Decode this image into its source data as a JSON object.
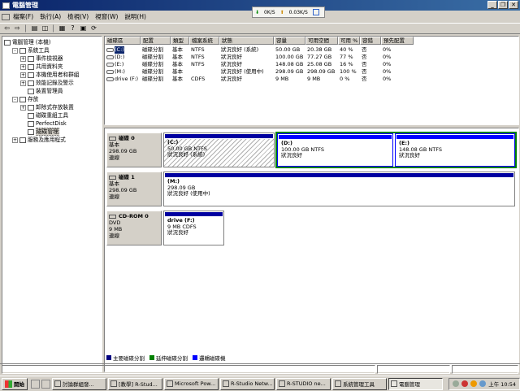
{
  "window": {
    "title": "電腦管理"
  },
  "netmeter": {
    "down": "0K/S",
    "up": "0.03K/S"
  },
  "menu": [
    "檔案(F)",
    "執行(A)",
    "檢視(V)",
    "視窗(W)",
    "說明(H)"
  ],
  "tree": [
    {
      "label": "電腦管理 (本機)",
      "level": 0,
      "expander": ""
    },
    {
      "label": "系統工具",
      "level": 1,
      "expander": "-"
    },
    {
      "label": "事件檢視器",
      "level": 2,
      "expander": "+"
    },
    {
      "label": "共用資料夾",
      "level": 2,
      "expander": "+"
    },
    {
      "label": "本機使用者和群組",
      "level": 2,
      "expander": "+"
    },
    {
      "label": "效能記錄及警示",
      "level": 2,
      "expander": "+"
    },
    {
      "label": "裝置管理員",
      "level": 2,
      "expander": ""
    },
    {
      "label": "存放",
      "level": 1,
      "expander": "-"
    },
    {
      "label": "卸除式存放裝置",
      "level": 2,
      "expander": "+"
    },
    {
      "label": "磁碟重組工具",
      "level": 2,
      "expander": ""
    },
    {
      "label": "PerfectDisk",
      "level": 2,
      "expander": ""
    },
    {
      "label": "磁碟管理",
      "level": 2,
      "expander": "",
      "selected": true
    },
    {
      "label": "服務及應用程式",
      "level": 1,
      "expander": "+"
    }
  ],
  "volume_table": {
    "columns": [
      "磁碟區",
      "配置",
      "類型",
      "檔案系統",
      "狀態",
      "容量",
      "可用空間",
      "可用 %",
      "容錯",
      "預先配置"
    ],
    "rows": [
      [
        "(C:)",
        "磁碟分割",
        "基本",
        "NTFS",
        "狀況良好 (系統)",
        "50.00 GB",
        "20.38 GB",
        "40 %",
        "否",
        "0%"
      ],
      [
        "(D:)",
        "磁碟分割",
        "基本",
        "NTFS",
        "狀況良好",
        "100.00 GB",
        "77.27 GB",
        "77 %",
        "否",
        "0%"
      ],
      [
        "(E:)",
        "磁碟分割",
        "基本",
        "NTFS",
        "狀況良好",
        "148.08 GB",
        "25.08 GB",
        "16 %",
        "否",
        "0%"
      ],
      [
        "(M:)",
        "磁碟分割",
        "基本",
        "",
        "狀況良好 (使用中)",
        "298.09 GB",
        "298.09 GB",
        "100 %",
        "否",
        "0%"
      ],
      [
        "drive (F:)",
        "磁碟分割",
        "基本",
        "CDFS",
        "狀況良好",
        "9 MB",
        "9 MB",
        "0 %",
        "否",
        "0%"
      ]
    ]
  },
  "disks": [
    {
      "name": "磁碟 0",
      "type": "基本",
      "size": "298.09 GB",
      "status": "連線",
      "partitions": [
        {
          "title": "(C:)",
          "detail": "50.00 GB NTFS",
          "status": "狀況良好 (系統)"
        },
        {
          "title": "(D:)",
          "detail": "100.00 GB NTFS",
          "status": "狀況良好"
        },
        {
          "title": "(E:)",
          "detail": "148.08 GB NTFS",
          "status": "狀況良好"
        }
      ]
    },
    {
      "name": "磁碟 1",
      "type": "基本",
      "size": "298.09 GB",
      "status": "連線",
      "partitions": [
        {
          "title": "(M:)",
          "detail": "298.09 GB",
          "status": "狀況良好 (使用中)"
        }
      ]
    },
    {
      "name": "CD-ROM 0",
      "type": "DVD",
      "size": "9 MB",
      "status": "連線",
      "partitions": [
        {
          "title": "drive  (F:)",
          "detail": "9 MB CDFS",
          "status": "狀況良好"
        }
      ]
    }
  ],
  "legend": [
    {
      "label": "主要磁碟分割",
      "color": "#000080"
    },
    {
      "label": "延伸磁碟分割",
      "color": "#008000"
    },
    {
      "label": "邏輯磁碟機",
      "color": "#0000ff"
    }
  ],
  "taskbar": {
    "start": "開始",
    "tasks": [
      "討論群組發...",
      "[教學] R-Stud...",
      "Microsoft Pow...",
      "R-Studio Netw...",
      "R-STUDIO ne...",
      "系統管理工具",
      "電腦管理"
    ],
    "clock": "上午 10:54"
  },
  "colors": {
    "primary_bar": "#0000a0",
    "extended_border": "#008000",
    "title_bar": "#0a246a"
  }
}
